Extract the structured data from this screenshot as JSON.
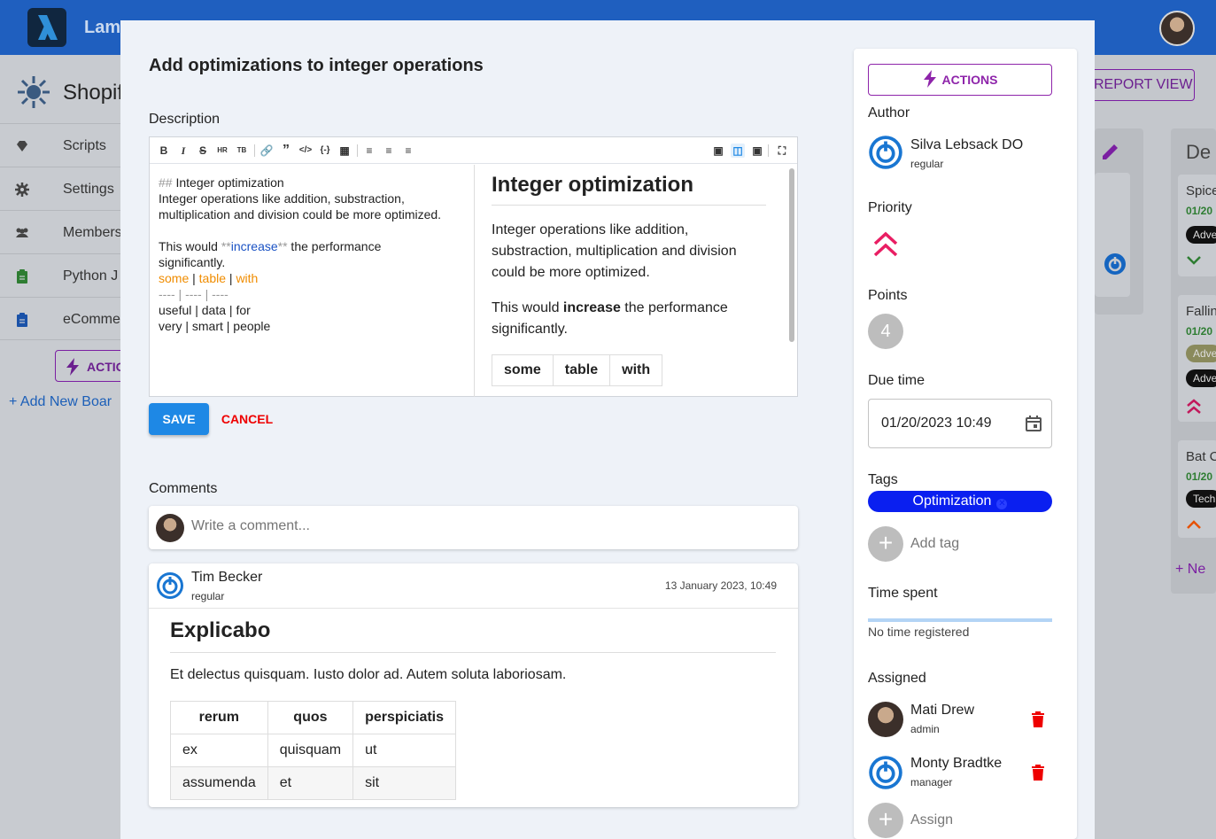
{
  "app": {
    "name": "Lam",
    "project_name": "Shopif",
    "nav": [
      {
        "label": "Scripts",
        "icon": "gem-icon"
      },
      {
        "label": "Settings",
        "icon": "gear-icon"
      },
      {
        "label": "Members",
        "icon": "people-icon"
      },
      {
        "label": "Python J",
        "icon": "clipboard-icon"
      },
      {
        "label": "eComme",
        "icon": "clipboard-icon"
      }
    ],
    "actions_label": "ACTIO",
    "add_board_label": "+ Add New Boar",
    "report_view_label": "REPORT VIEW"
  },
  "background_board": {
    "column_title": "De",
    "cards": [
      {
        "title": "Spice",
        "date": "01/20",
        "tag": "Adve"
      },
      {
        "title": "Fallin",
        "date": "01/20",
        "tag": "Adve",
        "tag2": "Adve"
      },
      {
        "title": "Bat C",
        "date": "01/20",
        "tag": "Tech"
      }
    ],
    "new_label": "+ Ne"
  },
  "modal": {
    "title": "Add optimizations to integer operations",
    "description_label": "Description",
    "editor": {
      "toolbar_left": [
        "B",
        "I",
        "S",
        "HR",
        "TB",
        "link",
        "quote",
        "code",
        "codeblock",
        "image",
        "ul",
        "ol",
        "task"
      ],
      "source_lines": [
        {
          "parts": [
            {
              "t": "## ",
              "c": "g"
            },
            {
              "t": "Integer optimization",
              "c": ""
            }
          ]
        },
        {
          "parts": [
            {
              "t": "Integer operations like addition, substraction,",
              "c": ""
            }
          ]
        },
        {
          "parts": [
            {
              "t": "multiplication and division could be more optimized.",
              "c": ""
            }
          ]
        },
        {
          "parts": [
            {
              "t": " ",
              "c": ""
            }
          ]
        },
        {
          "parts": [
            {
              "t": "This would ",
              "c": ""
            },
            {
              "t": "**",
              "c": "g"
            },
            {
              "t": "increase",
              "c": "b"
            },
            {
              "t": "**",
              "c": "g"
            },
            {
              "t": " the performance",
              "c": ""
            }
          ]
        },
        {
          "parts": [
            {
              "t": "significantly.",
              "c": ""
            }
          ]
        },
        {
          "parts": [
            {
              "t": "some",
              "c": "o"
            },
            {
              "t": " | ",
              "c": ""
            },
            {
              "t": "table",
              "c": "o"
            },
            {
              "t": " | ",
              "c": ""
            },
            {
              "t": "with",
              "c": "o"
            }
          ]
        },
        {
          "parts": [
            {
              "t": "---- | ---- | ----",
              "c": "g"
            }
          ]
        },
        {
          "parts": [
            {
              "t": "useful | data | for",
              "c": ""
            }
          ]
        },
        {
          "parts": [
            {
              "t": "very | smart | people",
              "c": ""
            }
          ]
        }
      ],
      "preview": {
        "heading": "Integer optimization",
        "para1": "Integer operations like addition, substraction, multiplication and division could be more optimized.",
        "para2_pre": "This would ",
        "para2_bold": "increase",
        "para2_post": " the performance significantly.",
        "table_headers": [
          "some",
          "table",
          "with"
        ]
      }
    },
    "save_label": "SAVE",
    "cancel_label": "CANCEL",
    "comments_label": "Comments",
    "comment_placeholder": "Write a comment...",
    "comment": {
      "author": "Tim Becker",
      "role": "regular",
      "date": "13 January 2023, 10:49",
      "heading": "Explicabo",
      "text": "Et delectus quisquam. Iusto dolor ad. Autem soluta laboriosam.",
      "table_headers": [
        "rerum",
        "quos",
        "perspiciatis"
      ],
      "table_rows": [
        [
          "ex",
          "quisquam",
          "ut"
        ],
        [
          "assumenda",
          "et",
          "sit"
        ]
      ]
    }
  },
  "panel": {
    "actions_label": "ACTIONS",
    "author_label": "Author",
    "author_name": "Silva Lebsack DO",
    "author_role": "regular",
    "priority_label": "Priority",
    "points_label": "Points",
    "points_value": "4",
    "due_label": "Due time",
    "due_value": "01/20/2023 10:49",
    "tags_label": "Tags",
    "tag": "Optimization",
    "add_tag_label": "Add tag",
    "time_spent_label": "Time spent",
    "time_spent_text": "No time registered",
    "assigned_label": "Assigned",
    "assignees": [
      {
        "name": "Mati Drew",
        "role": "admin"
      },
      {
        "name": "Monty Bradtke",
        "role": "manager"
      }
    ],
    "assign_label": "Assign"
  },
  "colors": {
    "primary": "#1e88e5",
    "accent_purple": "#8e24aa",
    "priority_pink": "#e91e63",
    "tag_blue": "#0a1ff0",
    "delete_red": "#e00000"
  }
}
